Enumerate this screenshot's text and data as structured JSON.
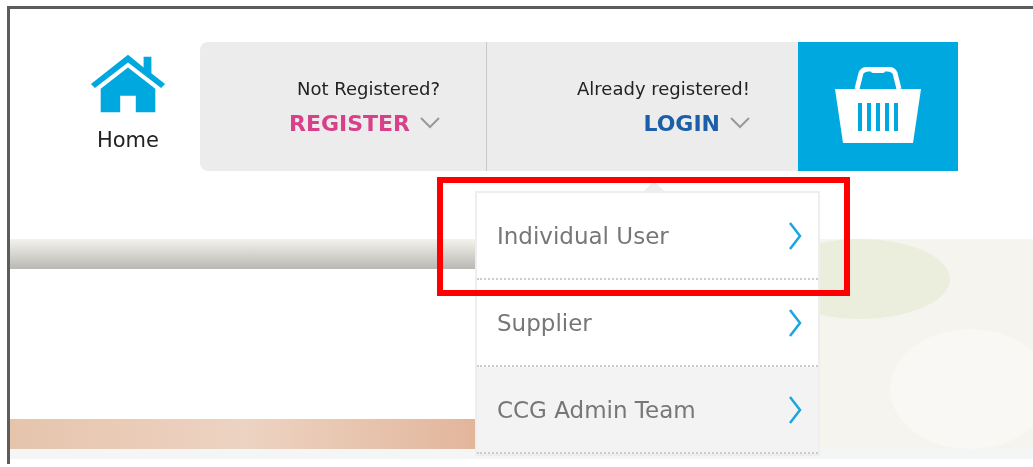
{
  "home": {
    "label": "Home"
  },
  "register": {
    "prompt": "Not Registered?",
    "action": "REGISTER"
  },
  "login": {
    "prompt": "Already registered!",
    "action": "LOGIN",
    "expanded": true
  },
  "login_menu": [
    {
      "label": "Individual User",
      "highlighted": true,
      "hovered": false
    },
    {
      "label": "Supplier",
      "highlighted": false,
      "hovered": false
    },
    {
      "label": "CCG Admin Team",
      "highlighted": false,
      "hovered": true
    }
  ]
}
